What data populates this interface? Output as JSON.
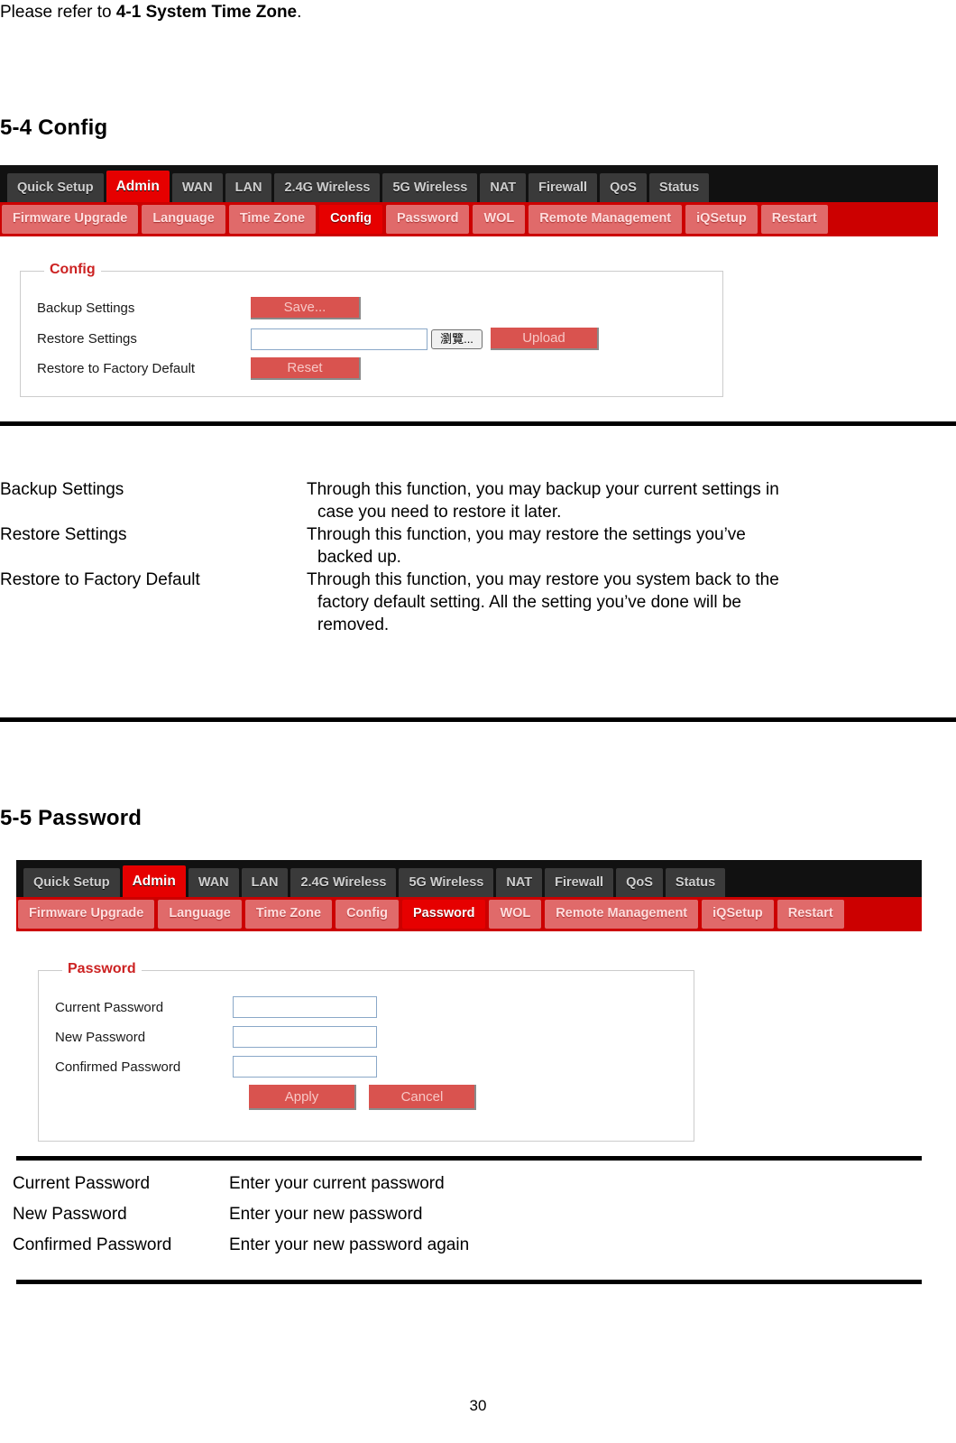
{
  "document": {
    "intro_prefix": "Please refer to ",
    "intro_bold": "4-1 System Time Zone",
    "intro_suffix": ".",
    "page_number": "30"
  },
  "section_config": {
    "heading": "5-4 Config",
    "nav": {
      "top_tabs": [
        {
          "label": "Quick Setup",
          "active": false
        },
        {
          "label": "Admin",
          "active": true
        },
        {
          "label": "WAN",
          "active": false
        },
        {
          "label": "LAN",
          "active": false
        },
        {
          "label": "2.4G Wireless",
          "active": false
        },
        {
          "label": "5G Wireless",
          "active": false
        },
        {
          "label": "NAT",
          "active": false
        },
        {
          "label": "Firewall",
          "active": false
        },
        {
          "label": "QoS",
          "active": false
        },
        {
          "label": "Status",
          "active": false
        }
      ],
      "sub_tabs": [
        {
          "label": "Firmware Upgrade",
          "active": false
        },
        {
          "label": "Language",
          "active": false
        },
        {
          "label": "Time Zone",
          "active": false
        },
        {
          "label": "Config",
          "active": true
        },
        {
          "label": "Password",
          "active": false
        },
        {
          "label": "WOL",
          "active": false
        },
        {
          "label": "Remote Management",
          "active": false
        },
        {
          "label": "iQSetup",
          "active": false
        },
        {
          "label": "Restart",
          "active": false
        }
      ]
    },
    "panel": {
      "legend": "Config",
      "rows": {
        "backup_label": "Backup Settings",
        "save_button": "Save...",
        "restore_label": "Restore Settings",
        "restore_input_value": "",
        "browse_button": "瀏覽...",
        "upload_button": "Upload",
        "factory_label": "Restore to Factory Default",
        "reset_button": "Reset"
      }
    },
    "descriptions": [
      {
        "term": "Backup Settings",
        "lines": [
          "Through this function, you may backup your current settings in",
          "case you need to restore it later."
        ]
      },
      {
        "term": "Restore Settings",
        "lines": [
          "Through this function, you may restore the settings you’ve",
          "backed up."
        ]
      },
      {
        "term": "Restore to Factory Default",
        "lines": [
          "Through this function, you may restore you system back to the",
          "factory default setting. All the setting you’ve done will be",
          "removed."
        ]
      }
    ]
  },
  "section_password": {
    "heading": "5-5 Password",
    "nav": {
      "top_tabs": [
        {
          "label": "Quick Setup",
          "active": false
        },
        {
          "label": "Admin",
          "active": true
        },
        {
          "label": "WAN",
          "active": false
        },
        {
          "label": "LAN",
          "active": false
        },
        {
          "label": "2.4G Wireless",
          "active": false
        },
        {
          "label": "5G Wireless",
          "active": false
        },
        {
          "label": "NAT",
          "active": false
        },
        {
          "label": "Firewall",
          "active": false
        },
        {
          "label": "QoS",
          "active": false
        },
        {
          "label": "Status",
          "active": false
        }
      ],
      "sub_tabs": [
        {
          "label": "Firmware Upgrade",
          "active": false
        },
        {
          "label": "Language",
          "active": false
        },
        {
          "label": "Time Zone",
          "active": false
        },
        {
          "label": "Config",
          "active": false
        },
        {
          "label": "Password",
          "active": true
        },
        {
          "label": "WOL",
          "active": false
        },
        {
          "label": "Remote Management",
          "active": false
        },
        {
          "label": "iQSetup",
          "active": false
        },
        {
          "label": "Restart",
          "active": false
        }
      ]
    },
    "panel": {
      "legend": "Password",
      "fields": [
        {
          "label": "Current Password",
          "value": ""
        },
        {
          "label": "New Password",
          "value": ""
        },
        {
          "label": "Confirmed Password",
          "value": ""
        }
      ],
      "apply_button": "Apply",
      "cancel_button": "Cancel"
    },
    "descriptions": [
      {
        "term": "Current Password",
        "def": "Enter your current password"
      },
      {
        "term": "New Password",
        "def": "Enter your new password"
      },
      {
        "term": "Confirmed Password",
        "def": "Enter your new password again"
      }
    ]
  },
  "colors": {
    "brand_red": "#cc0000",
    "active_red": "#e60000",
    "button_red": "#d9534f",
    "subtab_red": "#e06a6a",
    "nav_dark": "#111111",
    "tab_gray": "#3a3a3a"
  }
}
